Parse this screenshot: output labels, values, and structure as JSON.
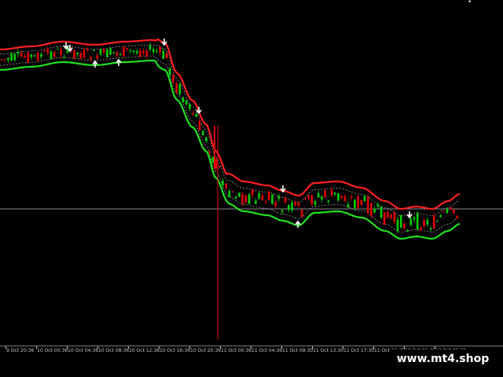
{
  "chart_data": {
    "type": "candlestick",
    "title": "",
    "xlabel": "",
    "ylabel": "",
    "x_tick_labels": [
      "9 Oct 20:36",
      "10 Oct 00:36",
      "10 Oct 04:36",
      "10 Oct 08:36",
      "10 Oct 12:36",
      "10 Oct 16:36",
      "10 Oct 20:36",
      "11 Oct 00:36",
      "11 Oct 04:36",
      "11 Oct 09:30",
      "11 Oct 13:30",
      "11 Oct 17:30",
      "11 Oct 21:30",
      "12 Oct 01:36",
      "12 Oct 05:36"
    ],
    "up_color": "#00d000",
    "down_color": "#e00000",
    "band_upper_color": "#ff2020",
    "band_lower_color": "#20e020",
    "band_inner_color": "#b8b8b8",
    "crosshair_color": "#8a8a8a",
    "arrow_color": "#ffffff",
    "series": [
      {
        "name": "",
        "values": []
      }
    ]
  },
  "watermark": "www.mt4.shop",
  "top_mark": "•"
}
